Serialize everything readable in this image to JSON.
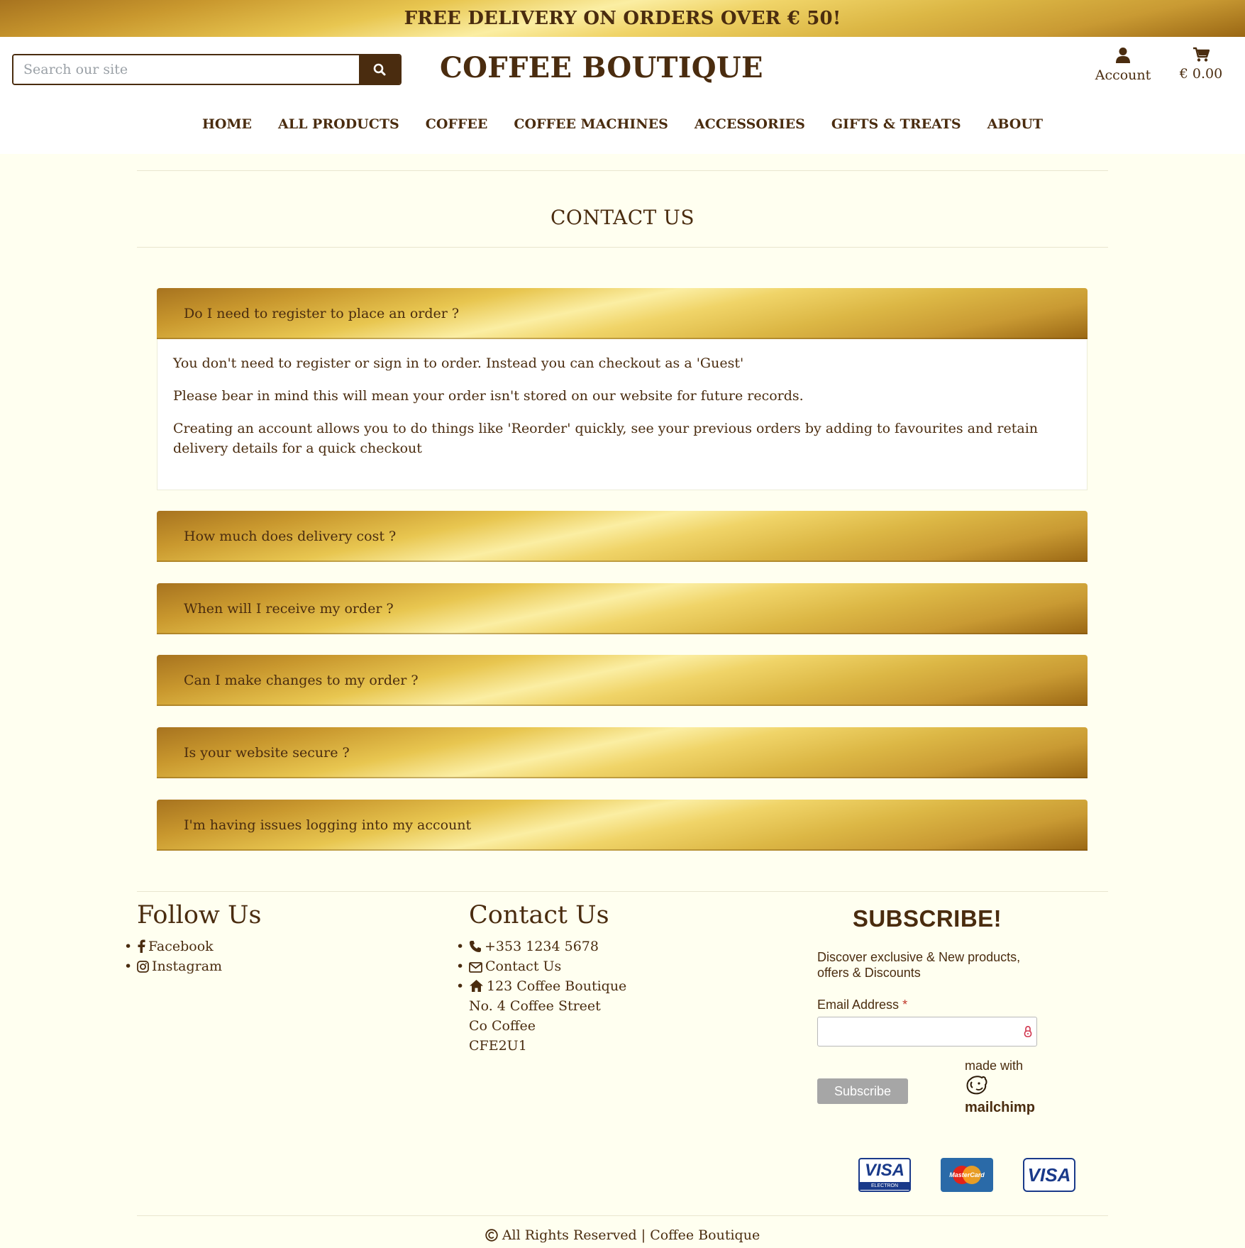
{
  "banner": {
    "text": "FREE DELIVERY ON ORDERS OVER € 50!"
  },
  "header": {
    "search_placeholder": "Search our site",
    "brand": "COFFEE BOUTIQUE",
    "account_label": "Account",
    "cart_total": "€ 0.00"
  },
  "nav": [
    "HOME",
    "ALL PRODUCTS",
    "COFFEE",
    "COFFEE MACHINES",
    "ACCESSORIES",
    "GIFTS & TREATS",
    "ABOUT"
  ],
  "page_title": "CONTACT US",
  "faq": [
    {
      "question": "Do I need to register to place an order ?",
      "expanded": true,
      "answer": [
        "You don't need to register or sign in to order. Instead you can checkout as a 'Guest'",
        "Please bear in mind this will mean your order isn't stored on our website for future records.",
        "Creating an account allows you to do things like 'Reorder' quickly, see your previous orders by adding to favourites and retain delivery details for a quick checkout"
      ]
    },
    {
      "question": "How much does delivery cost ?",
      "expanded": false
    },
    {
      "question": "When will I receive my order ?",
      "expanded": false
    },
    {
      "question": "Can I make changes to my order ?",
      "expanded": false
    },
    {
      "question": "Is your website secure ?",
      "expanded": false
    },
    {
      "question": "I'm having issues logging into my account",
      "expanded": false
    }
  ],
  "footer": {
    "follow": {
      "title": "Follow Us",
      "links": [
        "Facebook",
        "Instagram"
      ]
    },
    "contact": {
      "title": "Contact Us",
      "phone": "+353 1234 5678",
      "contact_link": "Contact Us",
      "address": [
        "123 Coffee Boutique",
        "No. 4 Coffee Street",
        "Co Coffee",
        "CFE2U1"
      ]
    },
    "subscribe": {
      "title": "SUBSCRIBE!",
      "description": "Discover exclusive & New products, offers & Discounts",
      "email_label": "Email Address",
      "required_mark": "*",
      "button": "Subscribe",
      "made_with": "made with",
      "mailchimp": "mailchimp"
    },
    "payment_cards": [
      "VISA",
      "MasterCard",
      "VISA"
    ],
    "visa_electron_sub": "ELECTRON",
    "copyright": "All Rights Reserved | Coffee Boutique"
  },
  "colors": {
    "brand_brown": "#4a2c0f",
    "background": "#fffff0",
    "gold_light": "#fbeea3",
    "gold_dark": "#a7731f"
  }
}
